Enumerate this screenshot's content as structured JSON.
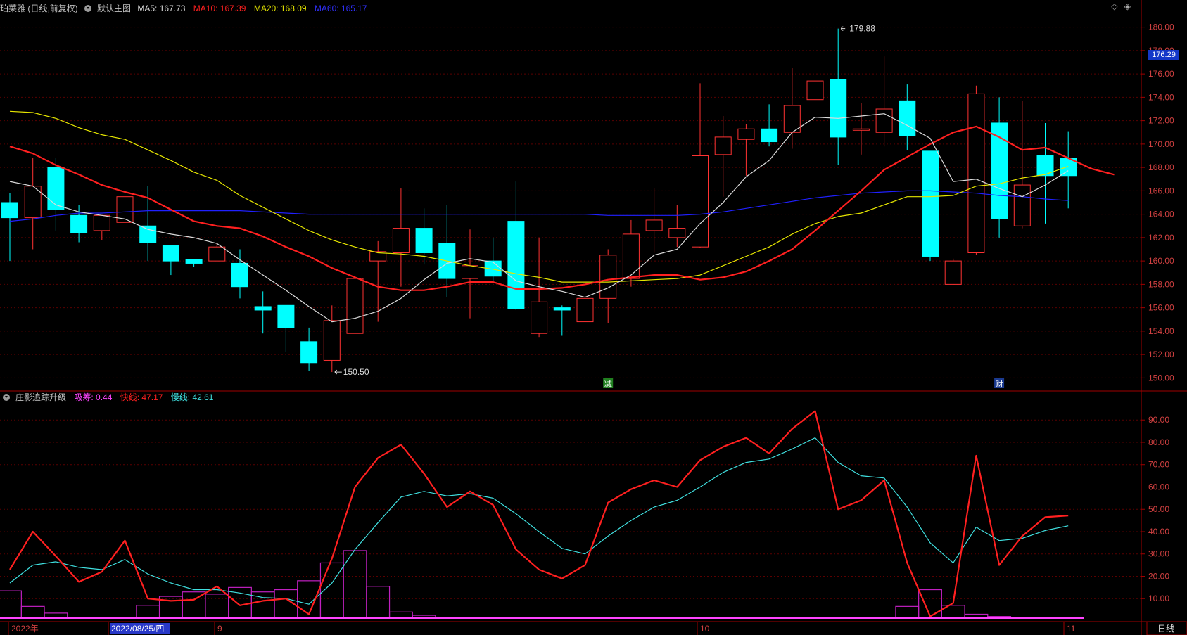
{
  "main_panel": {
    "title": "珀莱雅 (日线,前复权)",
    "template": "默认主图",
    "indicators": [
      {
        "label": "MA5: 167.73",
        "color": "#dcdcdc"
      },
      {
        "label": "MA10: 167.39",
        "color": "#ff2020"
      },
      {
        "label": "MA20: 168.09",
        "color": "#e6e600"
      },
      {
        "label": "MA60: 165.17",
        "color": "#2020ff"
      }
    ],
    "current_price": "176.29",
    "high_label": "179.88",
    "low_label": "150.50"
  },
  "sub_panel": {
    "title": "庄影追踪升级",
    "indicators": [
      {
        "label": "吸筹: 0.44",
        "color": "#ff44ff"
      },
      {
        "label": "快线: 47.17",
        "color": "#ff2020"
      },
      {
        "label": "慢线: 42.61",
        "color": "#40e0e0"
      }
    ]
  },
  "top_icons": [
    "◇",
    "◈"
  ],
  "x_axis": {
    "labels": [
      "2022年",
      "2022/08/25/四",
      "9",
      "10",
      "11"
    ],
    "period": "日线"
  },
  "event_markers": [
    "减",
    "财"
  ],
  "colors": {
    "up": "#ff3232",
    "down": "#00ffff",
    "grid": "#5a0000",
    "axis": "#a00000",
    "axis_text": "#d04040"
  },
  "chart_data": {
    "type": "candlestick",
    "price_axis": {
      "min": 149.0,
      "max": 181.0,
      "ticks": [
        150,
        152,
        154,
        156,
        158,
        160,
        162,
        164,
        166,
        168,
        170,
        172,
        174,
        176,
        178,
        180
      ]
    },
    "candles": [
      {
        "o": 165.0,
        "h": 165.8,
        "l": 160.0,
        "c": 163.7
      },
      {
        "o": 163.7,
        "h": 168.8,
        "l": 161.0,
        "c": 166.4
      },
      {
        "o": 168.0,
        "h": 168.8,
        "l": 162.6,
        "c": 164.4
      },
      {
        "o": 163.9,
        "h": 164.8,
        "l": 161.6,
        "c": 162.4
      },
      {
        "o": 162.6,
        "h": 163.6,
        "l": 161.8,
        "c": 163.9
      },
      {
        "o": 163.3,
        "h": 174.8,
        "l": 163.0,
        "c": 165.5
      },
      {
        "o": 163.0,
        "h": 166.4,
        "l": 160.0,
        "c": 161.6
      },
      {
        "o": 161.3,
        "h": 161.3,
        "l": 158.8,
        "c": 160.0
      },
      {
        "o": 160.1,
        "h": 160.1,
        "l": 159.5,
        "c": 159.8
      },
      {
        "o": 160.0,
        "h": 161.5,
        "l": 160.0,
        "c": 161.2
      },
      {
        "o": 159.8,
        "h": 161.0,
        "l": 156.8,
        "c": 157.8
      },
      {
        "o": 156.1,
        "h": 157.4,
        "l": 153.8,
        "c": 155.8
      },
      {
        "o": 156.2,
        "h": 156.2,
        "l": 152.2,
        "c": 154.3
      },
      {
        "o": 153.1,
        "h": 154.3,
        "l": 150.6,
        "c": 151.3
      },
      {
        "o": 151.5,
        "h": 156.2,
        "l": 150.5,
        "c": 154.9
      },
      {
        "o": 153.8,
        "h": 162.6,
        "l": 153.3,
        "c": 158.5
      },
      {
        "o": 160.0,
        "h": 161.7,
        "l": 154.8,
        "c": 160.8
      },
      {
        "o": 160.7,
        "h": 166.2,
        "l": 157.8,
        "c": 162.8
      },
      {
        "o": 162.8,
        "h": 164.5,
        "l": 159.7,
        "c": 160.7
      },
      {
        "o": 161.5,
        "h": 164.8,
        "l": 156.9,
        "c": 158.5
      },
      {
        "o": 158.5,
        "h": 162.7,
        "l": 155.1,
        "c": 159.6
      },
      {
        "o": 160.0,
        "h": 162.0,
        "l": 158.2,
        "c": 158.7
      },
      {
        "o": 163.4,
        "h": 166.8,
        "l": 155.8,
        "c": 155.9
      },
      {
        "o": 153.8,
        "h": 162.0,
        "l": 153.5,
        "c": 156.5
      },
      {
        "o": 156.0,
        "h": 156.2,
        "l": 153.6,
        "c": 155.8
      },
      {
        "o": 154.8,
        "h": 160.4,
        "l": 153.6,
        "c": 156.8
      },
      {
        "o": 156.8,
        "h": 161.0,
        "l": 154.7,
        "c": 160.5
      },
      {
        "o": 158.5,
        "h": 163.5,
        "l": 157.8,
        "c": 162.3
      },
      {
        "o": 162.6,
        "h": 166.2,
        "l": 160.7,
        "c": 163.5
      },
      {
        "o": 162.0,
        "h": 164.8,
        "l": 161.2,
        "c": 162.8
      },
      {
        "o": 161.2,
        "h": 175.2,
        "l": 161.1,
        "c": 169.0
      },
      {
        "o": 169.1,
        "h": 172.4,
        "l": 165.5,
        "c": 170.6
      },
      {
        "o": 170.4,
        "h": 171.7,
        "l": 167.3,
        "c": 171.3
      },
      {
        "o": 171.3,
        "h": 173.4,
        "l": 169.8,
        "c": 170.2
      },
      {
        "o": 171.0,
        "h": 176.5,
        "l": 169.6,
        "c": 173.3
      },
      {
        "o": 173.8,
        "h": 176.1,
        "l": 170.2,
        "c": 175.4
      },
      {
        "o": 175.5,
        "h": 179.88,
        "l": 168.2,
        "c": 170.6
      },
      {
        "o": 171.2,
        "h": 173.5,
        "l": 169.1,
        "c": 171.3
      },
      {
        "o": 171.0,
        "h": 177.5,
        "l": 169.8,
        "c": 173.0
      },
      {
        "o": 173.7,
        "h": 175.1,
        "l": 169.5,
        "c": 170.7
      },
      {
        "o": 169.4,
        "h": 169.4,
        "l": 160.0,
        "c": 160.4
      },
      {
        "o": 158.0,
        "h": 160.2,
        "l": 158.0,
        "c": 160.0
      },
      {
        "o": 160.7,
        "h": 175.0,
        "l": 160.5,
        "c": 174.3
      },
      {
        "o": 171.8,
        "h": 174.0,
        "l": 162.0,
        "c": 163.6
      },
      {
        "o": 163.0,
        "h": 173.7,
        "l": 162.8,
        "c": 166.5
      },
      {
        "o": 169.0,
        "h": 171.8,
        "l": 163.2,
        "c": 167.3
      },
      {
        "o": 168.8,
        "h": 171.1,
        "l": 164.5,
        "c": 167.3
      }
    ],
    "ma5": [
      166.8,
      166.4,
      164.8,
      164.2,
      163.9,
      163.6,
      162.7,
      162.3,
      162.0,
      161.5,
      160.1,
      158.8,
      157.5,
      156.1,
      154.8,
      155.1,
      155.7,
      156.8,
      158.4,
      159.8,
      160.2,
      159.9,
      158.3,
      157.8,
      157.4,
      156.9,
      157.7,
      158.8,
      160.5,
      161.0,
      163.2,
      165.0,
      167.2,
      168.6,
      171.0,
      172.3,
      172.2,
      172.4,
      172.6,
      171.6,
      170.5,
      166.8,
      167.0,
      166.2,
      165.5,
      166.5,
      167.73
    ],
    "ma10": [
      169.8,
      169.2,
      168.2,
      167.4,
      166.5,
      165.9,
      165.4,
      164.4,
      163.4,
      163.0,
      162.8,
      162.1,
      161.2,
      160.4,
      159.4,
      158.6,
      157.8,
      157.5,
      157.5,
      157.8,
      158.2,
      158.2,
      157.6,
      157.6,
      157.7,
      158.0,
      158.4,
      158.6,
      158.8,
      158.8,
      158.4,
      158.6,
      159.1,
      160.0,
      161.0,
      162.6,
      164.3,
      166.0,
      167.8,
      168.9,
      170.0,
      171.0,
      171.5,
      170.6,
      169.5,
      169.7,
      168.8,
      167.9,
      167.39
    ],
    "ma20": [
      172.8,
      172.7,
      172.2,
      171.4,
      170.8,
      170.4,
      169.5,
      168.6,
      167.6,
      166.9,
      165.6,
      164.6,
      163.6,
      162.6,
      161.8,
      161.2,
      160.7,
      160.6,
      160.4,
      160.0,
      159.6,
      159.3,
      158.9,
      158.6,
      158.2,
      158.2,
      158.2,
      158.3,
      158.4,
      158.5,
      158.8,
      159.6,
      160.4,
      161.2,
      162.3,
      163.2,
      163.8,
      164.1,
      164.8,
      165.5,
      165.5,
      165.6,
      166.4,
      166.6,
      167.1,
      167.4,
      168.09
    ],
    "ma60": [
      163.4,
      163.6,
      163.9,
      164.1,
      164.1,
      164.2,
      164.3,
      164.3,
      164.3,
      164.3,
      164.3,
      164.2,
      164.1,
      164.0,
      164.0,
      164.0,
      164.0,
      164.0,
      164.0,
      164.0,
      164.0,
      164.0,
      164.0,
      164.0,
      164.0,
      164.0,
      163.9,
      163.9,
      163.9,
      163.9,
      164.0,
      164.2,
      164.5,
      164.8,
      165.1,
      165.4,
      165.6,
      165.8,
      165.9,
      166.0,
      166.0,
      165.9,
      165.8,
      165.6,
      165.5,
      165.3,
      165.17
    ],
    "sub_axis": {
      "min": 0,
      "max": 97,
      "ticks": [
        10,
        20,
        30,
        40,
        50,
        60,
        70,
        80,
        90
      ]
    },
    "fast": [
      23.0,
      40.0,
      29.0,
      17.5,
      22.0,
      36.0,
      10.0,
      9.0,
      9.5,
      15.5,
      7.0,
      9.0,
      10.0,
      3.0,
      28.0,
      60.0,
      73.0,
      79.0,
      66.0,
      51.0,
      58.0,
      52.0,
      32.0,
      23.0,
      19.0,
      25.0,
      53.0,
      59.0,
      63.0,
      60.0,
      72.0,
      78.0,
      82.0,
      75.0,
      86.0,
      94.0,
      50.0,
      54.0,
      63.0,
      26.0,
      2.0,
      8.0,
      74.0,
      25.0,
      38.0,
      46.5,
      47.17
    ],
    "slow": [
      17.0,
      25.0,
      26.5,
      24.0,
      23.0,
      27.5,
      21.0,
      17.0,
      14.0,
      14.0,
      12.5,
      10.5,
      10.0,
      7.5,
      17.0,
      32.0,
      44.0,
      55.5,
      58.0,
      56.0,
      57.0,
      55.0,
      48.0,
      40.0,
      32.5,
      30.0,
      38.0,
      45.0,
      51.0,
      54.0,
      60.0,
      66.5,
      71.0,
      72.5,
      77.0,
      82.0,
      71.0,
      65.0,
      64.0,
      51.0,
      35.0,
      26.0,
      42.0,
      36.0,
      37.0,
      40.5,
      42.61
    ],
    "accumulate": [
      13.5,
      6.5,
      3.5,
      1.5,
      1.0,
      0.5,
      7.0,
      11.0,
      13.0,
      12.0,
      15.0,
      13.0,
      14.0,
      18.0,
      26.0,
      31.5,
      15.5,
      4.0,
      2.5,
      1.0,
      0.5,
      0.3,
      0.2,
      0.1,
      0.1,
      0.1,
      0.1,
      0.1,
      0.1,
      0.1,
      0.1,
      0.1,
      0.1,
      0.1,
      0.1,
      0.1,
      0.1,
      0.1,
      0.1,
      6.5,
      14.0,
      7.0,
      3.0,
      2.0,
      1.0,
      0.6,
      0.44
    ]
  }
}
